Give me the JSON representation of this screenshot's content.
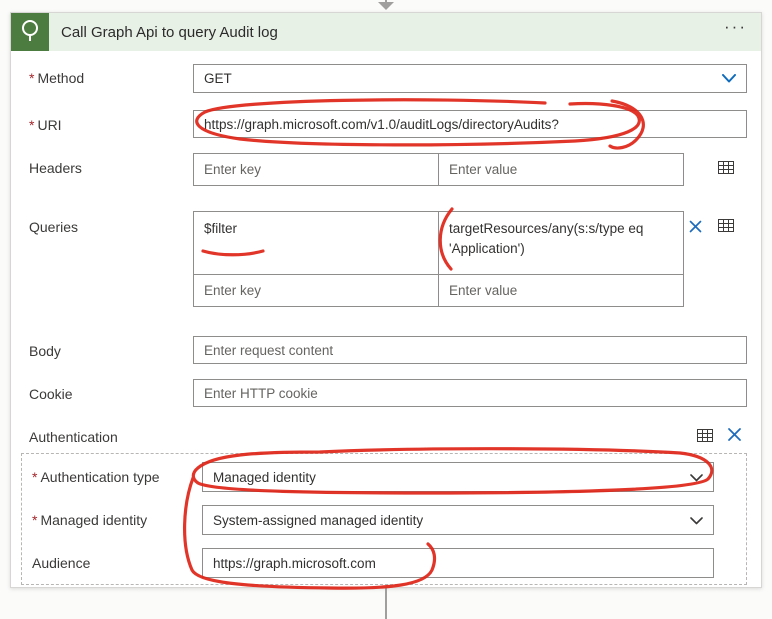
{
  "ui": {
    "asterisk": "*",
    "ellipsis": "···"
  },
  "card": {
    "title": "Call Graph Api to query Audit log"
  },
  "fields": {
    "method": {
      "label": "Method",
      "required": true,
      "value": "GET"
    },
    "uri": {
      "label": "URI",
      "required": true,
      "value": "https://graph.microsoft.com/v1.0/auditLogs/directoryAudits?"
    },
    "headers": {
      "label": "Headers",
      "key_placeholder": "Enter key",
      "value_placeholder": "Enter value"
    },
    "queries": {
      "label": "Queries",
      "rows": [
        {
          "key": "$filter",
          "value": "targetResources/any(s:s/type eq 'Application')"
        }
      ],
      "key_placeholder": "Enter key",
      "value_placeholder": "Enter value"
    },
    "body": {
      "label": "Body",
      "placeholder": "Enter request content"
    },
    "cookie": {
      "label": "Cookie",
      "placeholder": "Enter HTTP cookie"
    }
  },
  "authentication": {
    "label": "Authentication",
    "type": {
      "label": "Authentication type",
      "required": true,
      "value": "Managed identity"
    },
    "identity": {
      "label": "Managed identity",
      "required": true,
      "value": "System-assigned managed identity"
    },
    "audience": {
      "label": "Audience",
      "value": "https://graph.microsoft.com"
    }
  },
  "colors": {
    "header_green": "#e8f1e6",
    "icon_green": "#4c7c3f",
    "accent_blue": "#0f6cbd",
    "annotation_red": "#e02417",
    "required_red": "#a4262c"
  }
}
